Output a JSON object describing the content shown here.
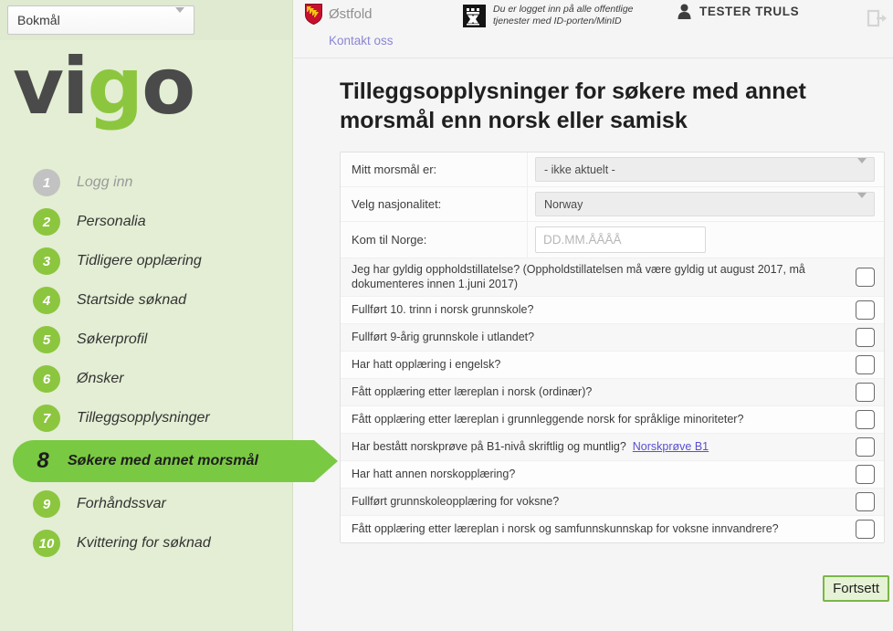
{
  "language_selector": {
    "value": "Bokmål",
    "icon": "chevron-down-icon"
  },
  "brand": {
    "logo_part1": "vi",
    "logo_part2": "g",
    "logo_part3": "o",
    "accent_color": "#8cc63f"
  },
  "sidebar": {
    "items": [
      {
        "number": "1",
        "label": "Logg inn",
        "state": "disabled"
      },
      {
        "number": "2",
        "label": "Personalia",
        "state": "done"
      },
      {
        "number": "3",
        "label": "Tidligere opplæring",
        "state": "done"
      },
      {
        "number": "4",
        "label": "Startside søknad",
        "state": "done"
      },
      {
        "number": "5",
        "label": "Søkerprofil",
        "state": "done"
      },
      {
        "number": "6",
        "label": "Ønsker",
        "state": "done"
      },
      {
        "number": "7",
        "label": "Tilleggsopplysninger",
        "state": "done"
      },
      {
        "number": "8",
        "label": "Søkere med annet morsmål",
        "state": "active"
      },
      {
        "number": "9",
        "label": "Forhåndssvar",
        "state": "done"
      },
      {
        "number": "10",
        "label": "Kvittering for søknad",
        "state": "done"
      }
    ]
  },
  "header": {
    "county": "Østfold",
    "county_icon": "shield-coat-of-arms-icon",
    "idporten_icon": "idporten-fortress-icon",
    "idporten_line1": "Du er logget inn på alle offentlige",
    "idporten_line2": "tjenester med ID-porten/MinID",
    "user_icon": "person-icon",
    "user_name": "TESTER TRULS",
    "logout_icon": "logout-icon",
    "contact_link": "Kontakt oss"
  },
  "page": {
    "title": "Tilleggsopplysninger for søkere med annet morsmål enn norsk eller samisk"
  },
  "form": {
    "fields": [
      {
        "label": "Mitt morsmål er:",
        "type": "select",
        "value": "- ikke aktuelt -",
        "name": "mother-tongue-select"
      },
      {
        "label": "Velg nasjonalitet:",
        "type": "select",
        "value": "Norway",
        "name": "nationality-select"
      },
      {
        "label": "Kom til Norge:",
        "type": "date",
        "value": "",
        "placeholder": "DD.MM.ÅÅÅÅ",
        "name": "arrival-date-input"
      }
    ],
    "questions": [
      {
        "text": "Jeg har gyldig oppholdstillatelse? (Oppholdstillatelsen må være gyldig ut august 2017, må dokumenteres innen 1.juni 2017)",
        "checked": false,
        "link": null
      },
      {
        "text": "Fullført 10. trinn i norsk grunnskole?",
        "checked": false,
        "link": null
      },
      {
        "text": "Fullført 9-årig grunnskole i utlandet?",
        "checked": false,
        "link": null
      },
      {
        "text": "Har hatt opplæring i engelsk?",
        "checked": false,
        "link": null
      },
      {
        "text": "Fått opplæring etter læreplan i norsk (ordinær)?",
        "checked": false,
        "link": null
      },
      {
        "text": "Fått opplæring etter læreplan i grunnleggende norsk for språklige minoriteter?",
        "checked": false,
        "link": null
      },
      {
        "text": "Har bestått norskprøve på B1-nivå skriftlig og muntlig?",
        "checked": false,
        "link": "Norskprøve B1"
      },
      {
        "text": "Har hatt annen norskopplæring?",
        "checked": false,
        "link": null
      },
      {
        "text": "Fullført grunnskoleopplæring for voksne?",
        "checked": false,
        "link": null
      },
      {
        "text": "Fått opplæring etter læreplan i norsk og samfunnskunnskap for voksne innvandrere?",
        "checked": false,
        "link": null
      }
    ]
  },
  "footer": {
    "continue_label": "Fortsett"
  }
}
